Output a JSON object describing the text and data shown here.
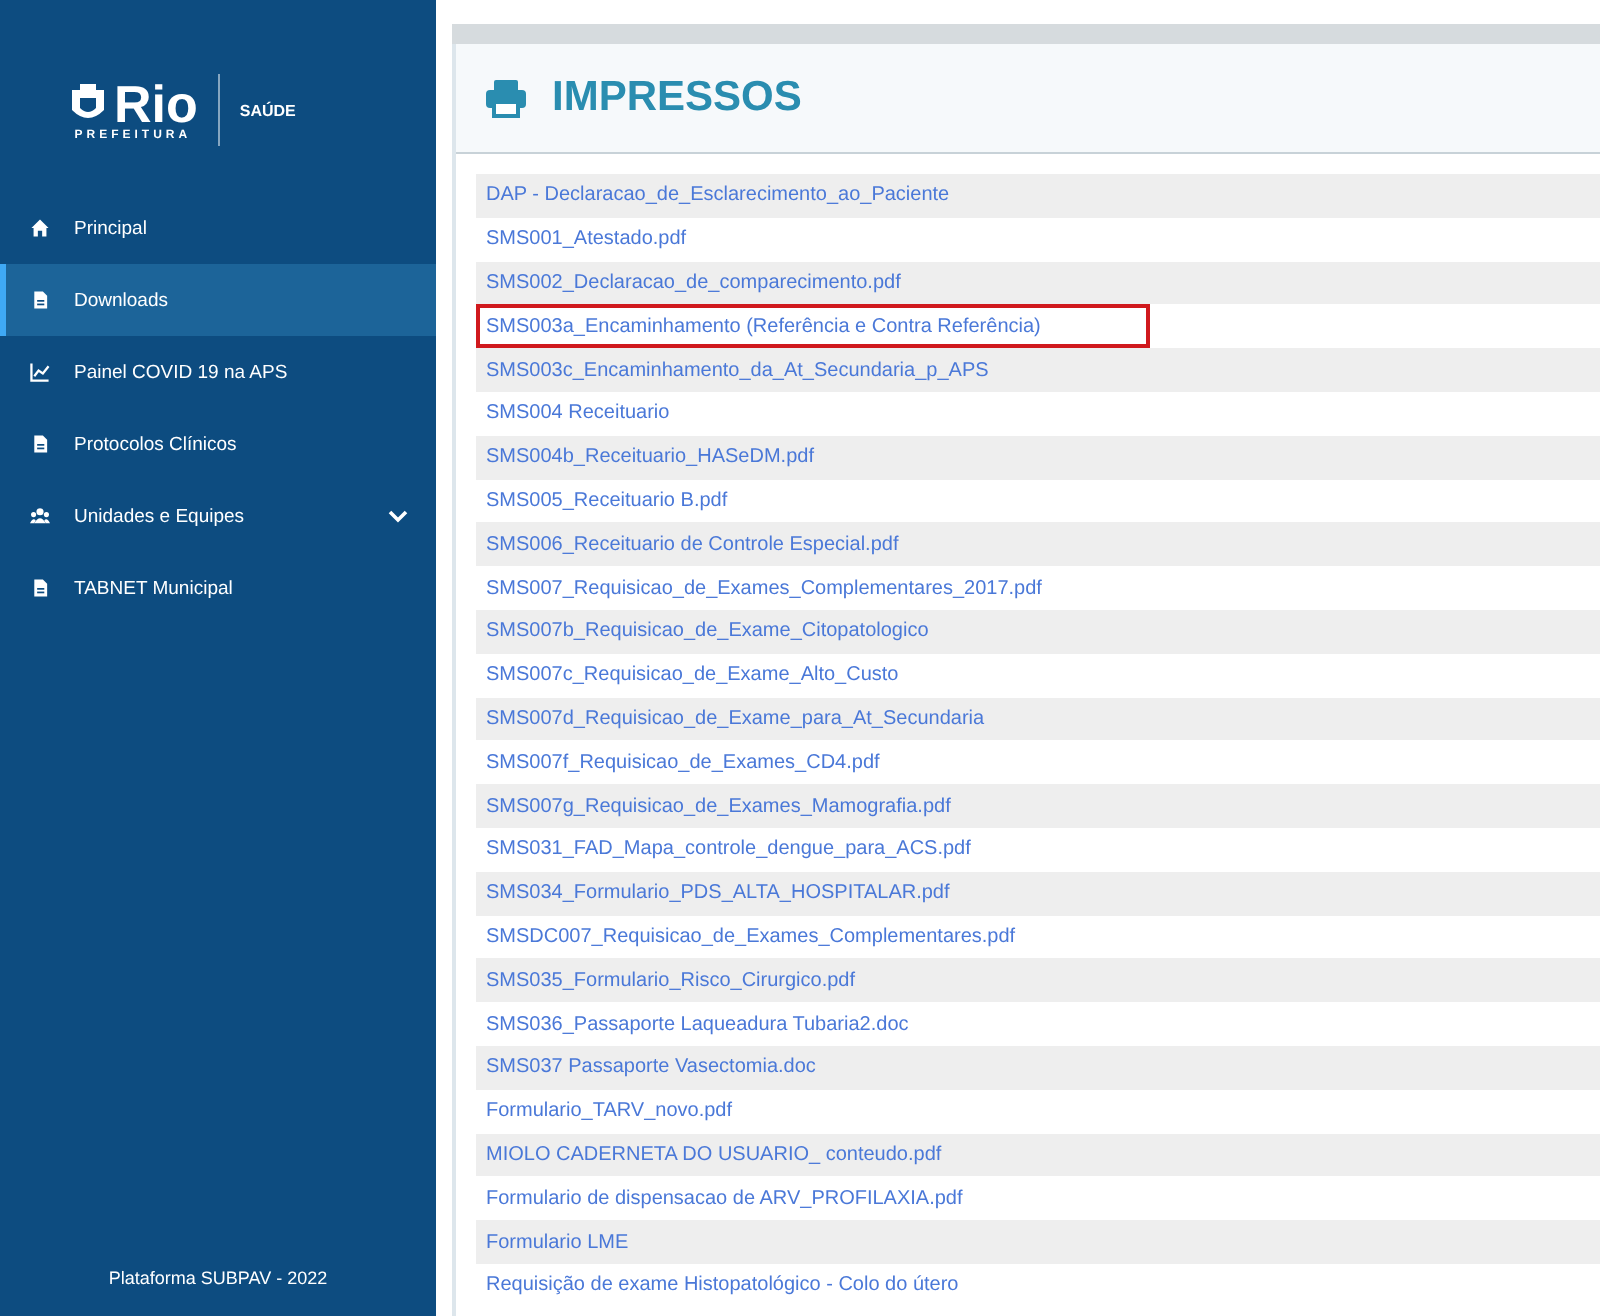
{
  "sidebar": {
    "logo": {
      "name": "Rio",
      "subtitle": "PREFEITURA",
      "section": "SAÚDE"
    },
    "items": [
      {
        "label": "Principal",
        "selected": false,
        "expandable": false
      },
      {
        "label": "Downloads",
        "selected": true,
        "expandable": false
      },
      {
        "label": "Painel COVID 19 na APS",
        "selected": false,
        "expandable": false
      },
      {
        "label": "Protocolos Clínicos",
        "selected": false,
        "expandable": false
      },
      {
        "label": "Unidades e Equipes",
        "selected": false,
        "expandable": true
      },
      {
        "label": "TABNET Municipal",
        "selected": false,
        "expandable": false
      }
    ],
    "footer": "Plataforma SUBPAV - 2022"
  },
  "panel": {
    "title": "IMPRESSOS",
    "files": [
      {
        "name": "DAP - Declaracao_de_Esclarecimento_ao_Paciente",
        "highlighted": false
      },
      {
        "name": "SMS001_Atestado.pdf",
        "highlighted": false
      },
      {
        "name": "SMS002_Declaracao_de_comparecimento.pdf",
        "highlighted": false
      },
      {
        "name": "SMS003a_Encaminhamento (Referência e Contra Referência)",
        "highlighted": true
      },
      {
        "name": "SMS003c_Encaminhamento_da_At_Secundaria_p_APS",
        "highlighted": false
      },
      {
        "name": "SMS004 Receituario",
        "highlighted": false
      },
      {
        "name": "SMS004b_Receituario_HASeDM.pdf",
        "highlighted": false
      },
      {
        "name": "SMS005_Receituario B.pdf",
        "highlighted": false
      },
      {
        "name": "SMS006_Receituario de Controle Especial.pdf",
        "highlighted": false
      },
      {
        "name": "SMS007_Requisicao_de_Exames_Complementares_2017.pdf",
        "highlighted": false
      },
      {
        "name": "SMS007b_Requisicao_de_Exame_Citopatologico",
        "highlighted": false
      },
      {
        "name": "SMS007c_Requisicao_de_Exame_Alto_Custo",
        "highlighted": false
      },
      {
        "name": "SMS007d_Requisicao_de_Exame_para_At_Secundaria",
        "highlighted": false
      },
      {
        "name": "SMS007f_Requisicao_de_Exames_CD4.pdf",
        "highlighted": false
      },
      {
        "name": "SMS007g_Requisicao_de_Exames_Mamografia.pdf",
        "highlighted": false
      },
      {
        "name": "SMS031_FAD_Mapa_controle_dengue_para_ACS.pdf",
        "highlighted": false
      },
      {
        "name": "SMS034_Formulario_PDS_ALTA_HOSPITALAR.pdf",
        "highlighted": false
      },
      {
        "name": "SMSDC007_Requisicao_de_Exames_Complementares.pdf",
        "highlighted": false
      },
      {
        "name": "SMS035_Formulario_Risco_Cirurgico.pdf",
        "highlighted": false
      },
      {
        "name": "SMS036_Passaporte Laqueadura Tubaria2.doc",
        "highlighted": false
      },
      {
        "name": "SMS037 Passaporte Vasectomia.doc",
        "highlighted": false
      },
      {
        "name": "Formulario_TARV_novo.pdf",
        "highlighted": false
      },
      {
        "name": "MIOLO CADERNETA DO USUARIO_ conteudo.pdf",
        "highlighted": false
      },
      {
        "name": "Formulario de dispensacao de ARV_PROFILAXIA.pdf",
        "highlighted": false
      },
      {
        "name": "Formulario LME",
        "highlighted": false
      },
      {
        "name": "Requisição de exame Histopatológico - Colo do útero",
        "highlighted": false
      }
    ]
  }
}
